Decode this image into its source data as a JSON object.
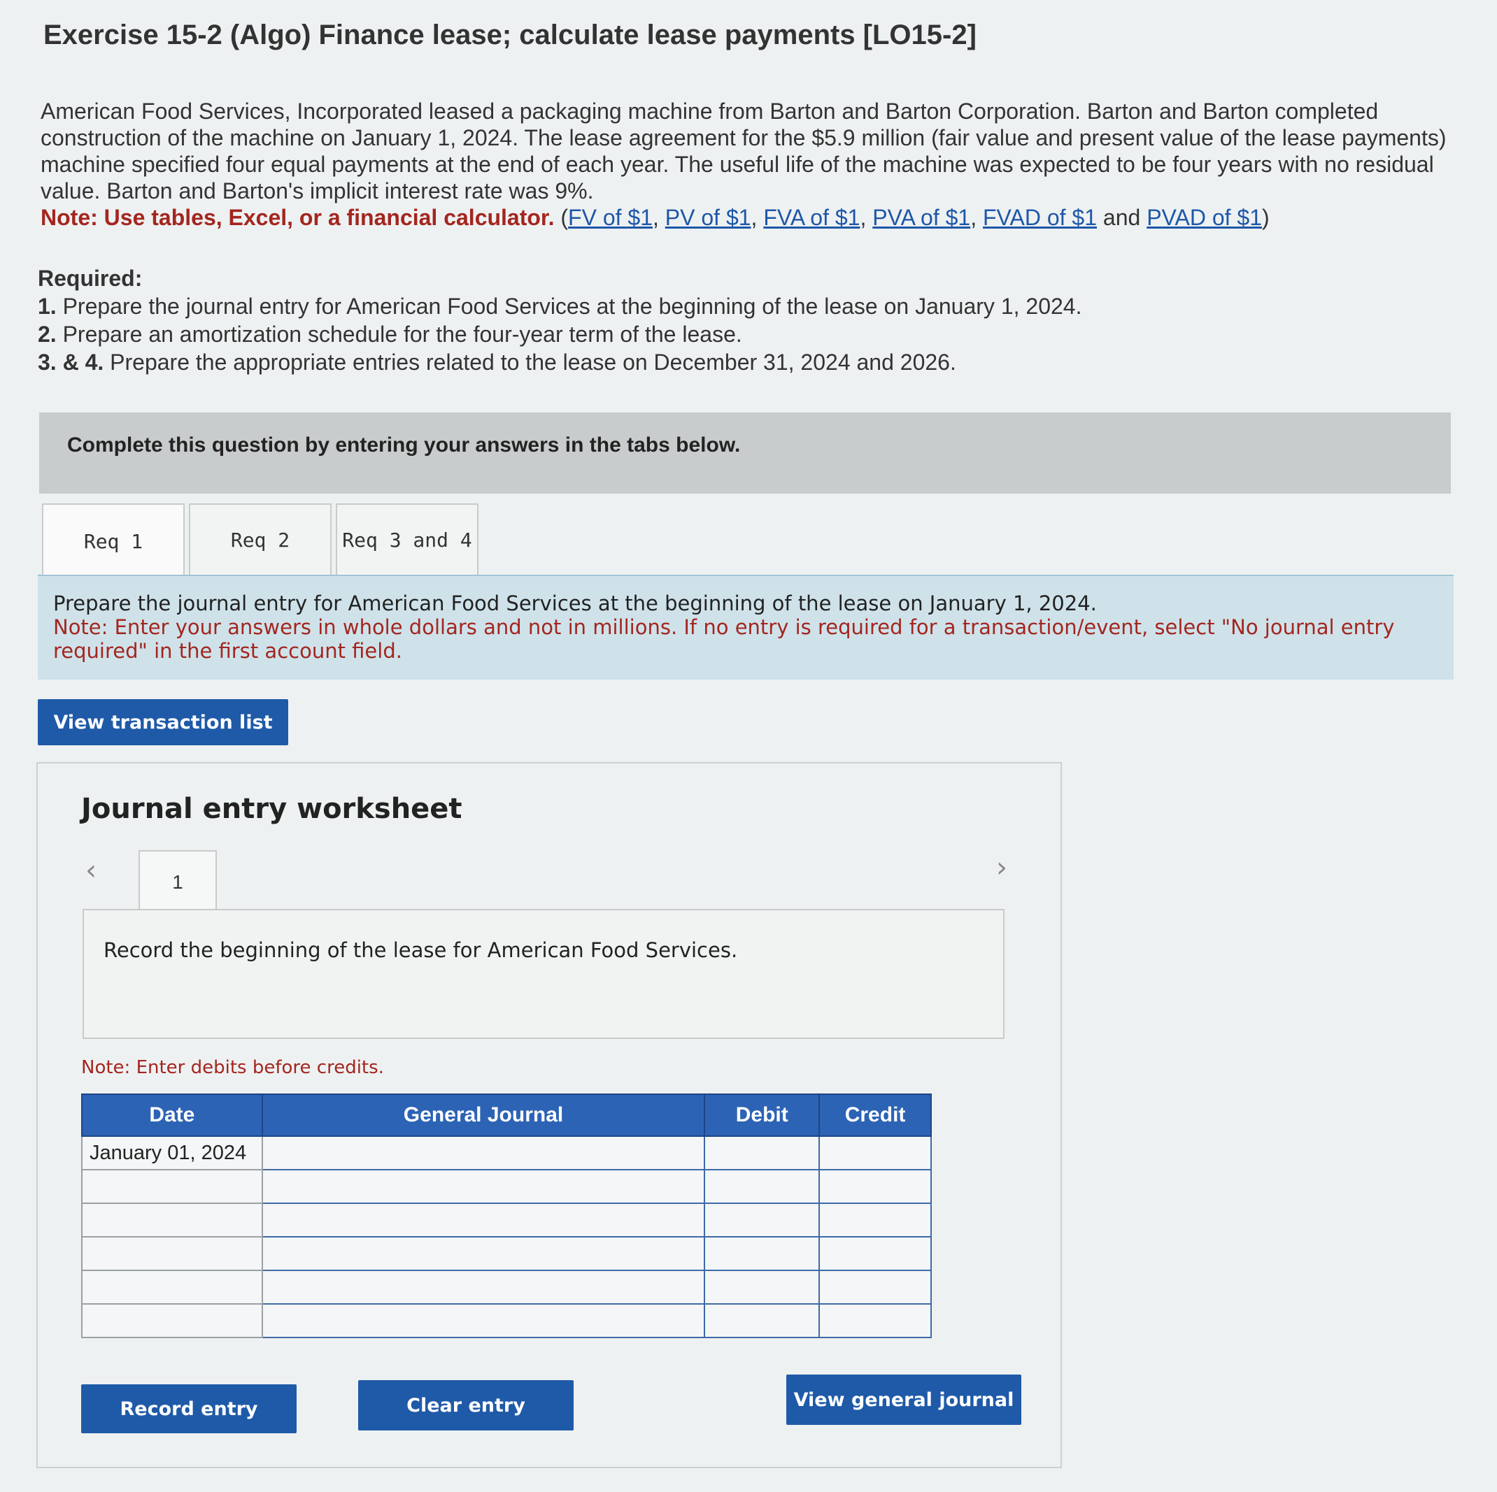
{
  "header": {
    "title": "Exercise 15-2 (Algo) Finance lease; calculate lease payments [LO15-2]"
  },
  "intro": {
    "text": "American Food Services, Incorporated leased a packaging machine from Barton and Barton Corporation. Barton and Barton completed construction of the machine on January 1, 2024. The lease agreement for the $5.9 million (fair value and present value of the lease payments) machine specified four equal payments at the end of each year. The useful life of the machine was expected to be four years with no residual value. Barton and Barton's implicit interest rate was 9%.",
    "note_label": "Note: Use tables, Excel, or a financial calculator.",
    "links": [
      "FV of $1",
      "PV of $1",
      "FVA of $1",
      "PVA of $1",
      "FVAD of $1",
      "PVAD of $1"
    ],
    "and_word": "and"
  },
  "required": {
    "heading": "Required:",
    "items": [
      {
        "num": "1.",
        "text": "Prepare the journal entry for American Food Services at the beginning of the lease on January 1, 2024."
      },
      {
        "num": "2.",
        "text": "Prepare an amortization schedule for the four-year term of the lease."
      },
      {
        "num": "3. & 4.",
        "text": "Prepare the appropriate entries related to the lease on December 31, 2024 and 2026."
      }
    ]
  },
  "banner": {
    "text": "Complete this question by entering your answers in the tabs below."
  },
  "tabs": [
    {
      "label": "Req 1"
    },
    {
      "label": "Req 2"
    },
    {
      "label": "Req 3 and 4"
    }
  ],
  "instructions": {
    "line1": "Prepare the journal entry for American Food Services at the beginning of the lease on January 1, 2024.",
    "note": "Note: Enter your answers in whole dollars and not in millions. If no entry is required for a transaction/event, select \"No journal entry required\" in the first account field."
  },
  "buttons": {
    "view_transaction_list": "View transaction list",
    "record_entry": "Record entry",
    "clear_entry": "Clear entry",
    "view_general_journal": "View general journal"
  },
  "worksheet": {
    "title": "Journal entry worksheet",
    "page_number": "1",
    "prompt": "Record the beginning of the lease for American Food Services.",
    "note": "Note: Enter debits before credits."
  },
  "journal": {
    "headers": {
      "date": "Date",
      "account": "General Journal",
      "debit": "Debit",
      "credit": "Credit"
    },
    "rows": [
      {
        "date": "January 01, 2024"
      },
      {
        "date": ""
      },
      {
        "date": ""
      },
      {
        "date": ""
      },
      {
        "date": ""
      },
      {
        "date": ""
      }
    ]
  },
  "colors": {
    "primary_button": "#1f5aa8",
    "table_header": "#2c63b5",
    "note_red": "#a3261f",
    "instruction_bg": "#cfe2ea"
  }
}
